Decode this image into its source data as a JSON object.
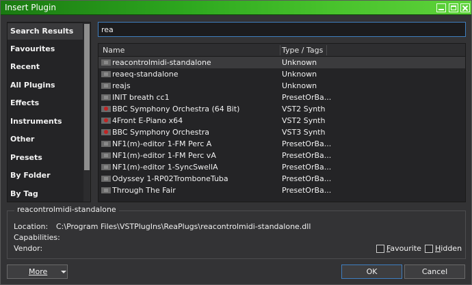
{
  "window": {
    "title": "Insert Plugin"
  },
  "sidebar": {
    "items": [
      {
        "label": "Search Results",
        "selected": true
      },
      {
        "label": "Favourites"
      },
      {
        "label": "Recent"
      },
      {
        "label": "All Plugins"
      },
      {
        "label": "Effects"
      },
      {
        "label": "Instruments"
      },
      {
        "label": "Other"
      },
      {
        "label": "Presets"
      },
      {
        "label": "By Folder"
      },
      {
        "label": "By Tag"
      }
    ]
  },
  "search": {
    "value": "rea"
  },
  "list": {
    "columns": {
      "name": "Name",
      "type": "Type / Tags"
    },
    "rows": [
      {
        "name": "reacontrolmidi-standalone",
        "type": "Unknown",
        "icon": "plugin-icon",
        "selected": true
      },
      {
        "name": "reaeq-standalone",
        "type": "Unknown",
        "icon": "plugin-icon"
      },
      {
        "name": "reajs",
        "type": "Unknown",
        "icon": "plugin-icon"
      },
      {
        "name": "INIT breath cc1",
        "type": "PresetOrBa...",
        "icon": "plugin-icon"
      },
      {
        "name": "BBC Symphony Orchestra (64 Bit)",
        "type": "VST2 Synth",
        "icon": "vst-plugin-icon"
      },
      {
        "name": "4Front E-Piano x64",
        "type": "VST2 Synth",
        "icon": "vst-plugin-icon"
      },
      {
        "name": "BBC Symphony Orchestra",
        "type": "VST3 Synth",
        "icon": "vst-plugin-icon"
      },
      {
        "name": "NF1(m)-editor 1-FM Perc  A",
        "type": "PresetOrBa...",
        "icon": "plugin-icon"
      },
      {
        "name": "NF1(m)-editor 1-FM Perc vA",
        "type": "PresetOrBa...",
        "icon": "plugin-icon"
      },
      {
        "name": "NF1(m)-editor 1-SyncSwellA",
        "type": "PresetOrBa...",
        "icon": "plugin-icon"
      },
      {
        "name": "Odyssey 1-RP02TromboneTuba",
        "type": "PresetOrBa...",
        "icon": "plugin-icon"
      },
      {
        "name": "Through The Fair",
        "type": "PresetOrBa...",
        "icon": "plugin-icon"
      }
    ]
  },
  "details": {
    "title": "reacontrolmidi-standalone",
    "location_label": "Location:",
    "location_value": "C:\\Program Files\\VSTPlugIns\\ReaPlugs\\reacontrolmidi-standalone.dll",
    "capabilities_label": "Capabilities:",
    "vendor_label": "Vendor:",
    "favourite_label": "Favourite",
    "hidden_label": "Hidden"
  },
  "buttons": {
    "more": "More",
    "ok": "OK",
    "cancel": "Cancel"
  },
  "colors": {
    "titlebar": "#2ea81f",
    "focus": "#3f7fc0",
    "vst_icon": "#c02424"
  }
}
